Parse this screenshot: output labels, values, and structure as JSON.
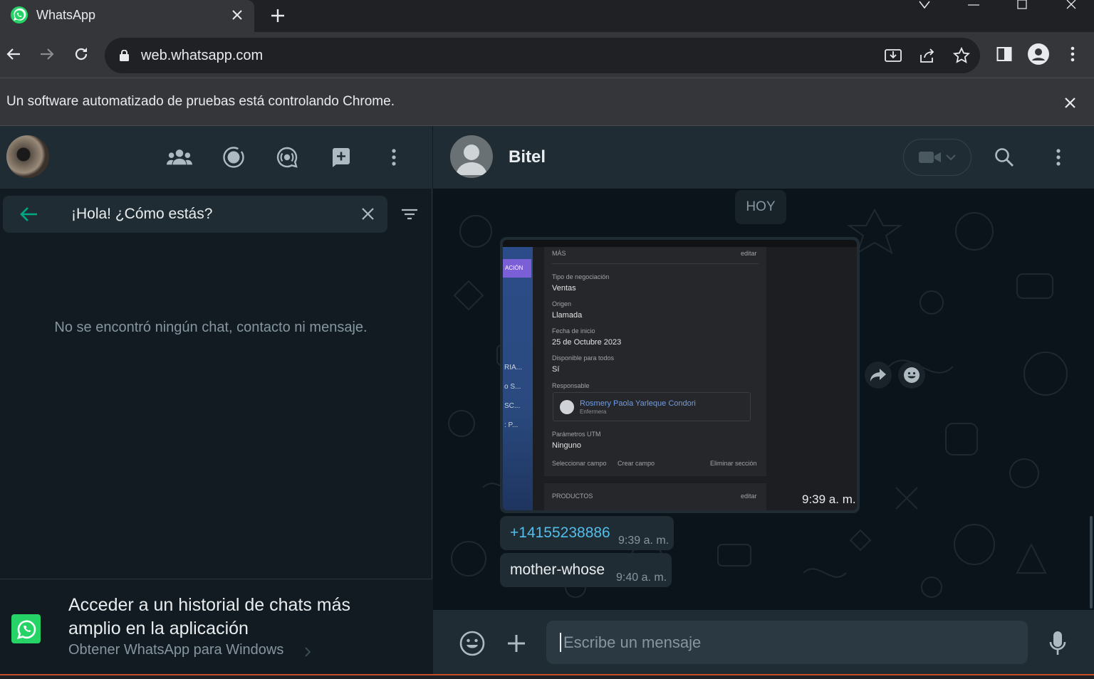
{
  "browser": {
    "tab_title": "WhatsApp",
    "url": "web.whatsapp.com",
    "infobar_message": "Un software automatizado de pruebas está controlando Chrome."
  },
  "sidebar": {
    "search_query": "¡Hola! ¿Cómo estás?",
    "empty_message": "No se encontró ningún chat, contacto ni mensaje.",
    "promo_title": "Acceder a un historial de chats más amplio en la aplicación",
    "promo_link": "Obtener WhatsApp para Windows"
  },
  "chat": {
    "contact_name": "Bitel",
    "day_label": "HOY",
    "image_message": {
      "time": "9:39 a. m.",
      "screenshot": {
        "section_header": "MÁS",
        "edit": "editar",
        "nav_selected": "ACIÓN",
        "nav_items": [
          "RIA...",
          "o S...",
          "SC...",
          ": P..."
        ],
        "fields": [
          {
            "label": "Tipo de negociación",
            "value": "Ventas"
          },
          {
            "label": "Origen",
            "value": "Llamada"
          },
          {
            "label": "Fecha de inicio",
            "value": "25 de Octubre 2023"
          },
          {
            "label": "Disponible para todos",
            "value": "Sí"
          },
          {
            "label": "Responsable",
            "value": ""
          },
          {
            "label": "Parámetros UTM",
            "value": "Ninguno"
          }
        ],
        "responsible_name": "Rosmery Paola Yarleque Condori",
        "responsible_role": "Enfermera",
        "select_field": "Seleccionar campo",
        "create_field": "Crear campo",
        "delete_section": "Eliminar sección",
        "products_header": "PRODUCTOS",
        "products_edit": "editar"
      }
    },
    "messages": [
      {
        "text": "+14155238886",
        "time": "9:39 a. m.",
        "is_link": true
      },
      {
        "text": "mother-whose",
        "time": "9:40 a. m.",
        "is_link": false
      }
    ],
    "composer_placeholder": "Escribe un mensaje"
  },
  "colors": {
    "whatsapp_green": "#25d366",
    "panel_dark": "#111b21",
    "header_dark": "#202c33",
    "link_blue": "#53bdeb",
    "accent_green": "#00a884"
  }
}
